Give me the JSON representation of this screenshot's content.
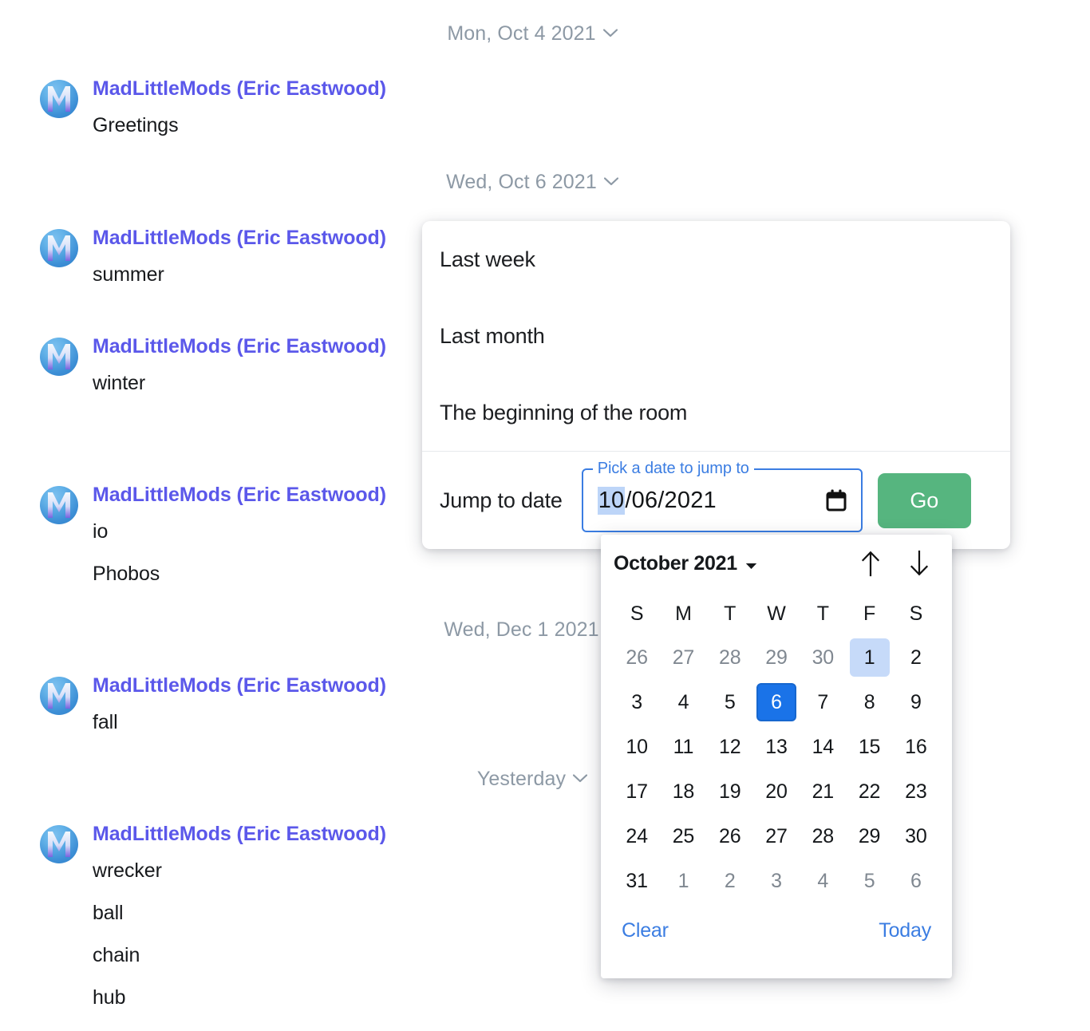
{
  "timeline": {
    "separators": {
      "oct4": "Mon, Oct 4 2021",
      "oct6": "Wed, Oct 6 2021",
      "dec1": "Wed, Dec 1 2021",
      "yesterday": "Yesterday"
    },
    "sender_name": "MadLittleMods (Eric Eastwood)",
    "groups": [
      {
        "messages": [
          "Greetings"
        ]
      },
      {
        "messages": [
          "summer"
        ]
      },
      {
        "messages": [
          "winter"
        ]
      },
      {
        "messages": [
          "io",
          "Phobos"
        ]
      },
      {
        "messages": [
          "fall"
        ]
      },
      {
        "messages": [
          "wrecker",
          "ball",
          "chain",
          "hub"
        ]
      }
    ]
  },
  "menu": {
    "items": [
      {
        "label": "Last week"
      },
      {
        "label": "Last month"
      },
      {
        "label": "The beginning of the room"
      }
    ],
    "jump": {
      "label": "Jump to date",
      "field_legend": "Pick a date to jump to",
      "value_selected_segment": "10",
      "value_rest": "/06/2021",
      "value_full": "10/06/2021",
      "go_label": "Go",
      "go_color": "#56b57f"
    }
  },
  "calendar": {
    "month_label": "October 2021",
    "prev_icon": "arrow-up-icon",
    "next_icon": "arrow-down-icon",
    "weekdays": [
      "S",
      "M",
      "T",
      "W",
      "T",
      "F",
      "S"
    ],
    "weeks": [
      [
        {
          "d": "26",
          "state": "muted"
        },
        {
          "d": "27",
          "state": "muted"
        },
        {
          "d": "28",
          "state": "muted"
        },
        {
          "d": "29",
          "state": "muted"
        },
        {
          "d": "30",
          "state": "muted"
        },
        {
          "d": "1",
          "state": "today"
        },
        {
          "d": "2",
          "state": ""
        }
      ],
      [
        {
          "d": "3",
          "state": ""
        },
        {
          "d": "4",
          "state": ""
        },
        {
          "d": "5",
          "state": ""
        },
        {
          "d": "6",
          "state": "selected"
        },
        {
          "d": "7",
          "state": ""
        },
        {
          "d": "8",
          "state": ""
        },
        {
          "d": "9",
          "state": ""
        }
      ],
      [
        {
          "d": "10",
          "state": ""
        },
        {
          "d": "11",
          "state": ""
        },
        {
          "d": "12",
          "state": ""
        },
        {
          "d": "13",
          "state": ""
        },
        {
          "d": "14",
          "state": ""
        },
        {
          "d": "15",
          "state": ""
        },
        {
          "d": "16",
          "state": ""
        }
      ],
      [
        {
          "d": "17",
          "state": ""
        },
        {
          "d": "18",
          "state": ""
        },
        {
          "d": "19",
          "state": ""
        },
        {
          "d": "20",
          "state": ""
        },
        {
          "d": "21",
          "state": ""
        },
        {
          "d": "22",
          "state": ""
        },
        {
          "d": "23",
          "state": ""
        }
      ],
      [
        {
          "d": "24",
          "state": ""
        },
        {
          "d": "25",
          "state": ""
        },
        {
          "d": "26",
          "state": ""
        },
        {
          "d": "27",
          "state": ""
        },
        {
          "d": "28",
          "state": ""
        },
        {
          "d": "29",
          "state": ""
        },
        {
          "d": "30",
          "state": ""
        }
      ],
      [
        {
          "d": "31",
          "state": ""
        },
        {
          "d": "1",
          "state": "muted"
        },
        {
          "d": "2",
          "state": "muted"
        },
        {
          "d": "3",
          "state": "muted"
        },
        {
          "d": "4",
          "state": "muted"
        },
        {
          "d": "5",
          "state": "muted"
        },
        {
          "d": "6",
          "state": "muted"
        }
      ]
    ],
    "clear_label": "Clear",
    "today_label": "Today",
    "selected_day": "6",
    "today_day": "1",
    "accent_selected": "#1a73e8",
    "accent_today": "#c6daf9",
    "link_color": "#3b7de2"
  },
  "colors": {
    "sender": "#5b58ea",
    "separator_text": "#8d99a5",
    "message_text": "#17191c"
  }
}
